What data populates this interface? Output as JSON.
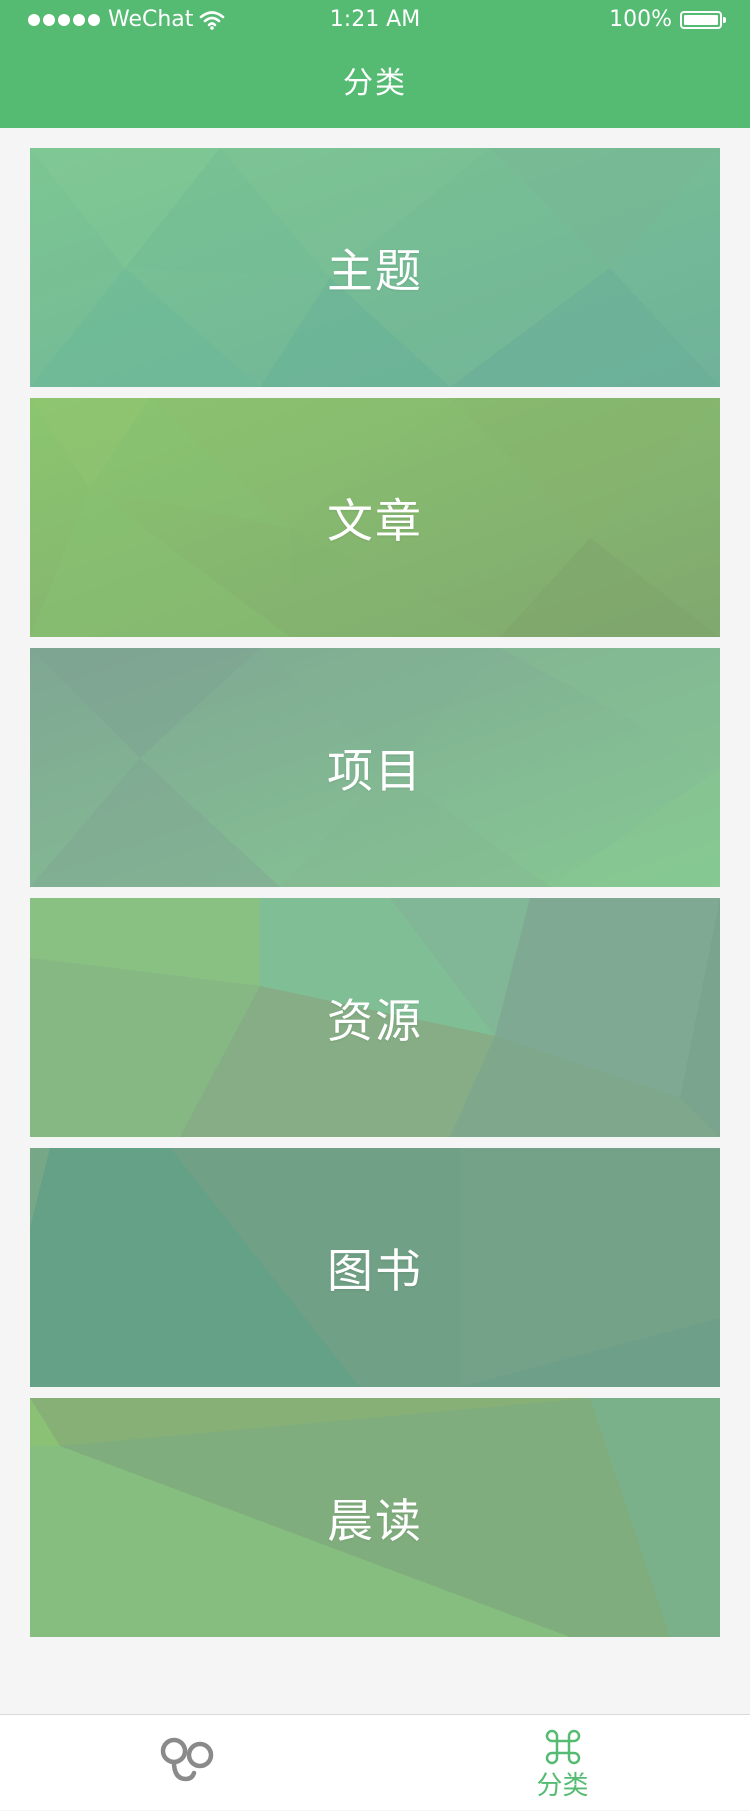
{
  "status_bar": {
    "carrier": "WeChat",
    "time": "1:21 AM",
    "battery": "100%",
    "signal_icon": "signal-dots-icon",
    "wifi_icon": "wifi-icon",
    "battery_icon": "battery-icon"
  },
  "nav": {
    "title": "分类"
  },
  "categories": [
    {
      "label": "主题"
    },
    {
      "label": "文章"
    },
    {
      "label": "项目"
    },
    {
      "label": "资源"
    },
    {
      "label": "图书"
    },
    {
      "label": "晨读"
    }
  ],
  "tab_bar": {
    "items": [
      {
        "icon": "logo-icon",
        "active": false
      },
      {
        "icon": "command-icon",
        "label": "分类",
        "active": true
      }
    ]
  },
  "colors": {
    "primary_green": "#55bb72",
    "inactive_icon": "#8a8a8a",
    "background": "#f5f5f5"
  }
}
